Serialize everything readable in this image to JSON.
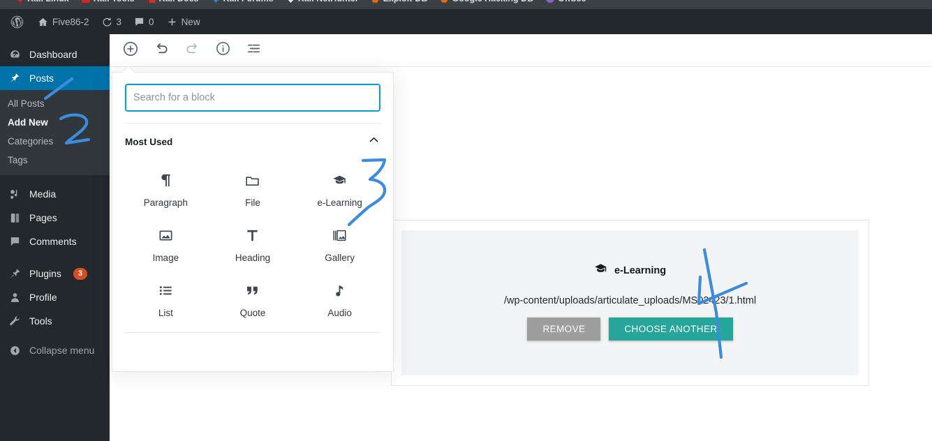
{
  "browser": {
    "bookmarks": [
      {
        "label": "Kali Linux",
        "icon": "dragon-icon"
      },
      {
        "label": "Kali Tools",
        "icon": "red-square-icon"
      },
      {
        "label": "Kali Docs",
        "icon": "book-icon"
      },
      {
        "label": "Kali Forums",
        "icon": "blue-dragon-icon"
      },
      {
        "label": "Kali NetHunter",
        "icon": "white-dragon-icon"
      },
      {
        "label": "Exploit-DB",
        "icon": "flame-icon"
      },
      {
        "label": "Google Hacking DB",
        "icon": "flame-icon"
      },
      {
        "label": "OffSec",
        "icon": "purple-circle-icon"
      }
    ]
  },
  "adminbar": {
    "logo": "wordpress-logo",
    "site_name": "Five86-2",
    "updates_count": "3",
    "comments_count": "0",
    "new_label": "New"
  },
  "sidebar": {
    "items": [
      {
        "label": "Dashboard",
        "icon": "dashboard-icon",
        "current": false
      },
      {
        "label": "Posts",
        "icon": "pin-icon",
        "current": true
      },
      {
        "label": "Media",
        "icon": "media-icon",
        "current": false
      },
      {
        "label": "Pages",
        "icon": "pages-icon",
        "current": false
      },
      {
        "label": "Comments",
        "icon": "comments-icon",
        "current": false
      },
      {
        "label": "Plugins",
        "icon": "plugins-icon",
        "current": false,
        "badge": "3"
      },
      {
        "label": "Profile",
        "icon": "profile-icon",
        "current": false
      },
      {
        "label": "Tools",
        "icon": "tools-icon",
        "current": false
      },
      {
        "label": "Collapse menu",
        "icon": "collapse-icon",
        "current": false
      }
    ],
    "posts_submenu": [
      {
        "label": "All Posts",
        "current": false
      },
      {
        "label": "Add New",
        "current": true
      },
      {
        "label": "Categories",
        "current": false
      },
      {
        "label": "Tags",
        "current": false
      }
    ]
  },
  "toolbar": {
    "buttons": [
      {
        "name": "add-block",
        "icon": "plus-circle-icon",
        "disabled": false
      },
      {
        "name": "undo",
        "icon": "undo-icon",
        "disabled": false
      },
      {
        "name": "redo",
        "icon": "redo-icon",
        "disabled": true
      },
      {
        "name": "content-info",
        "icon": "info-icon",
        "disabled": false
      },
      {
        "name": "block-navigation",
        "icon": "list-view-icon",
        "disabled": false
      }
    ]
  },
  "inserter": {
    "search": {
      "value": "",
      "placeholder": "Search for a block"
    },
    "panel_title": "Most Used",
    "collapse_icon": "chevron-up-icon",
    "blocks": [
      {
        "label": "Paragraph",
        "icon": "pilcrow-icon"
      },
      {
        "label": "File",
        "icon": "folder-icon"
      },
      {
        "label": "e-Learning",
        "icon": "graduation-cap-icon"
      },
      {
        "label": "Image",
        "icon": "image-icon"
      },
      {
        "label": "Heading",
        "icon": "heading-t-icon"
      },
      {
        "label": "Gallery",
        "icon": "gallery-icon"
      },
      {
        "label": "List",
        "icon": "list-icon"
      },
      {
        "label": "Quote",
        "icon": "quote-icon"
      },
      {
        "label": "Audio",
        "icon": "audio-note-icon"
      }
    ]
  },
  "elearning_block": {
    "icon": "graduation-cap-icon",
    "title": "e-Learning",
    "path": "/wp-content/uploads/articulate_uploads/MS02423/1.html",
    "remove_label": "REMOVE",
    "choose_label": "CHOOSE ANOTHER"
  },
  "annotations": {
    "color": "#3d8bdb",
    "marks": [
      "1",
      "2",
      "3",
      "4"
    ]
  },
  "colors": {
    "admin_dark": "#23282d",
    "submenu_dark": "#32373c",
    "wp_blue": "#0073aa",
    "focus_blue": "#00a0d2",
    "teal": "#26a69a",
    "gray_button": "#9e9e9e",
    "badge_orange": "#d54e21",
    "annotation_blue": "#3d8bdb"
  }
}
